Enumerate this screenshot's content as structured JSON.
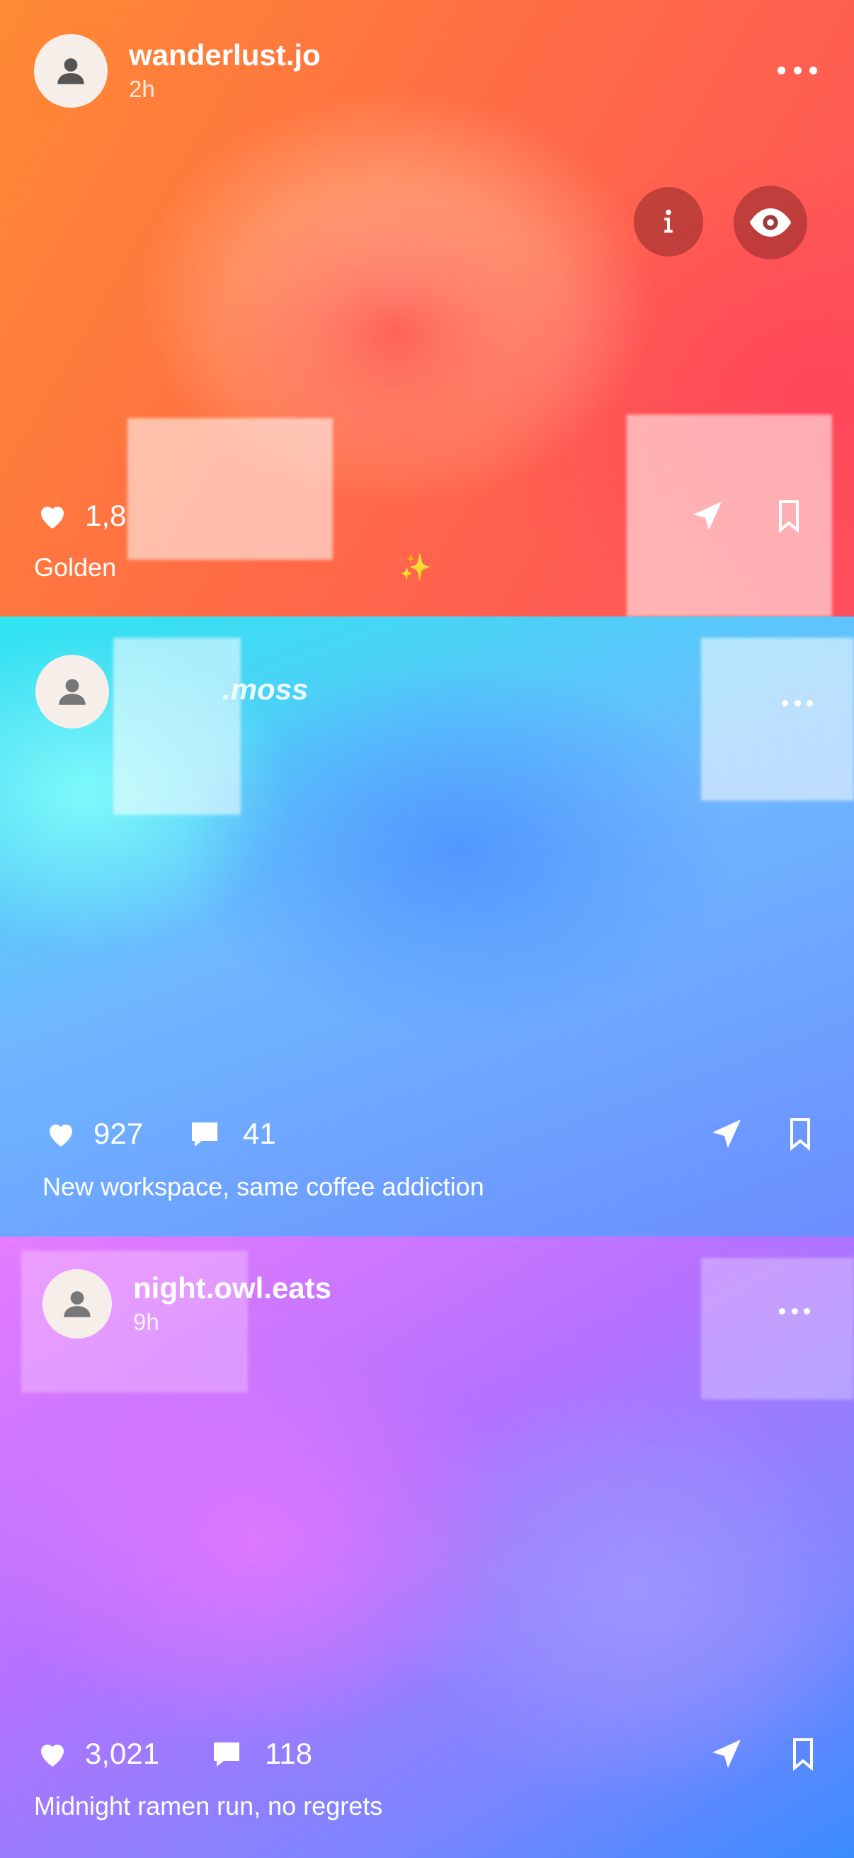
{
  "posts": [
    {
      "username": "wanderlust.jo",
      "time": "2h",
      "likes": "1,8",
      "comments": "",
      "caption": "Golden",
      "caption_emoji": "✨"
    },
    {
      "username": ".moss",
      "time": "",
      "likes": "927",
      "comments": "41",
      "caption": "New workspace, same coffee addiction"
    },
    {
      "username": "night.owl.eats",
      "time": "9h",
      "likes": "3,021",
      "comments": "118",
      "caption": "Midnight ramen run, no regrets"
    }
  ],
  "overlay_buttons": {
    "info_icon": "info-icon",
    "eye_icon": "eye-icon"
  },
  "icons": [
    "user-icon",
    "more-icon",
    "heart-icon",
    "comment-icon",
    "send-icon",
    "bookmark-icon"
  ]
}
